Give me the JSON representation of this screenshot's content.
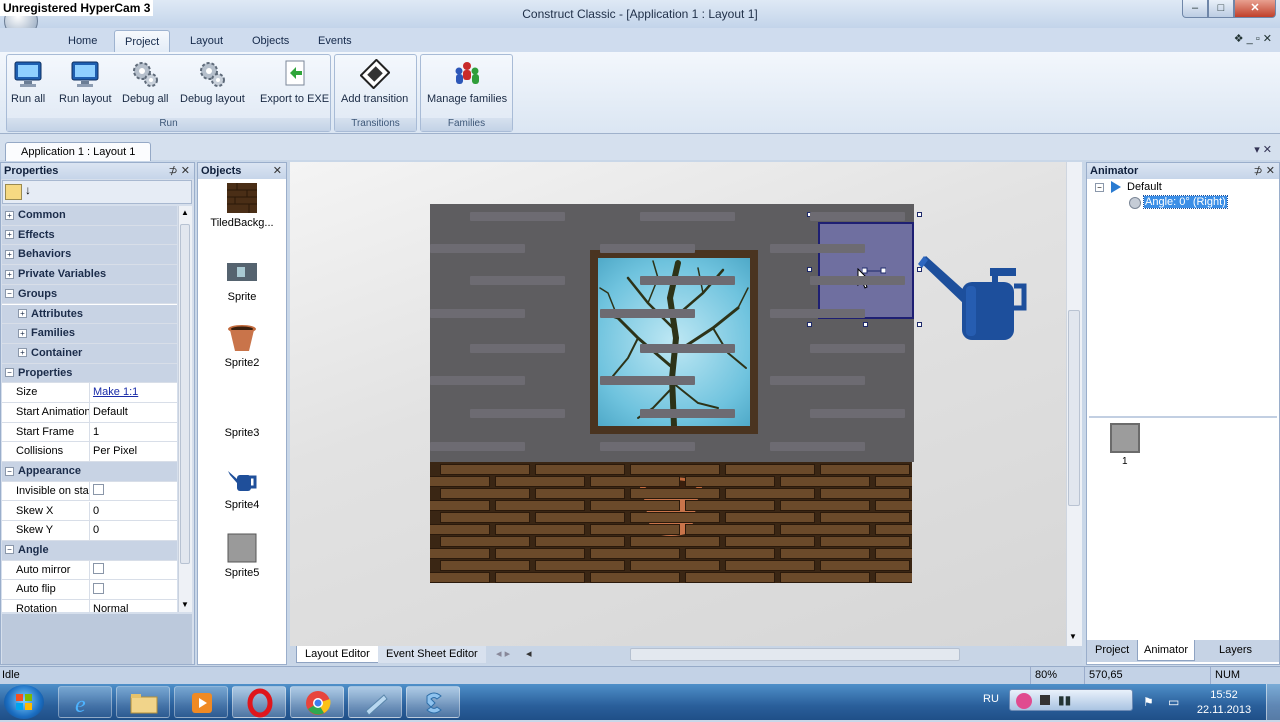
{
  "overlay": {
    "watermark": "Unregistered HyperCam 3"
  },
  "window": {
    "title": "Construct Classic - [Application 1 : Layout 1]",
    "min": "–",
    "max": "□",
    "close": "✕"
  },
  "ribbon_tabs": [
    "Home",
    "Project",
    "Layout",
    "Objects",
    "Events"
  ],
  "ribbon_tab_active": "Project",
  "ribbon_right": "❖ _ ▫ ✕",
  "ribbon_groups": [
    {
      "label": "Run",
      "buttons": [
        "Run all",
        "Run layout",
        "Debug all",
        "Debug layout",
        "Export to EXE"
      ]
    },
    {
      "label": "Transitions",
      "buttons": [
        "Add transition"
      ]
    },
    {
      "label": "Families",
      "buttons": [
        "Manage families"
      ]
    }
  ],
  "document_tab": "Application 1 : Layout 1",
  "document_tab_controls": "▾ ✕",
  "properties": {
    "title": "Properties",
    "pin": "⊅ ✕",
    "rows": [
      {
        "type": "cat",
        "label": "Common",
        "exp": "+"
      },
      {
        "type": "cat",
        "label": "Effects",
        "exp": "+"
      },
      {
        "type": "cat",
        "label": "Behaviors",
        "exp": "+"
      },
      {
        "type": "cat",
        "label": "Private Variables",
        "exp": "+"
      },
      {
        "type": "cat",
        "label": "Groups",
        "exp": "−"
      },
      {
        "type": "sub",
        "label": "Attributes",
        "exp": "+"
      },
      {
        "type": "sub",
        "label": "Families",
        "exp": "+"
      },
      {
        "type": "sub",
        "label": "Container",
        "exp": "+"
      },
      {
        "type": "cat",
        "label": "Properties",
        "exp": "−"
      },
      {
        "type": "kv",
        "key": "Size",
        "value": "Make 1:1",
        "link": true
      },
      {
        "type": "kv",
        "key": "Start Animation",
        "value": "Default"
      },
      {
        "type": "kv",
        "key": "Start Frame",
        "value": "1"
      },
      {
        "type": "kv",
        "key": "Collisions",
        "value": "Per Pixel"
      },
      {
        "type": "cat",
        "label": "Appearance",
        "exp": "−"
      },
      {
        "type": "kv",
        "key": "Invisible on start",
        "value": "",
        "check": true
      },
      {
        "type": "kv",
        "key": "Skew X",
        "value": "0"
      },
      {
        "type": "kv",
        "key": "Skew Y",
        "value": "0"
      },
      {
        "type": "cat",
        "label": "Angle",
        "exp": "−"
      },
      {
        "type": "kv",
        "key": "Auto mirror",
        "value": "",
        "check": true
      },
      {
        "type": "kv",
        "key": "Auto flip",
        "value": "",
        "check": true
      },
      {
        "type": "kv",
        "key": "Rotation",
        "value": "Normal"
      }
    ]
  },
  "objects": {
    "title": "Objects",
    "close": "✕",
    "items": [
      {
        "label": "TiledBackg...",
        "icon": "brick-tile-icon"
      },
      {
        "label": "Sprite",
        "icon": "sprite-icon"
      },
      {
        "label": "Sprite2",
        "icon": "flower-pot-icon"
      },
      {
        "label": "Sprite3",
        "icon": "blank-sprite-icon"
      },
      {
        "label": "Sprite4",
        "icon": "watering-can-icon"
      },
      {
        "label": "Sprite5",
        "icon": "grey-box-icon"
      }
    ]
  },
  "editor_tabs": [
    "Layout Editor",
    "Event Sheet Editor"
  ],
  "animator": {
    "title": "Animator",
    "pin": "⊅ ✕",
    "tree_root": "Default",
    "tree_child": "Angle: 0° (Right)",
    "frame_label": "1",
    "tabs": [
      "Project",
      "Animator",
      "Layers"
    ],
    "active_tab": "Animator"
  },
  "status": {
    "left": "Idle",
    "zoom": "80%",
    "coords": "570,65",
    "num": "NUM"
  },
  "taskbar": {
    "lang": "RU",
    "time": "15:52",
    "date": "22.11.2013"
  }
}
